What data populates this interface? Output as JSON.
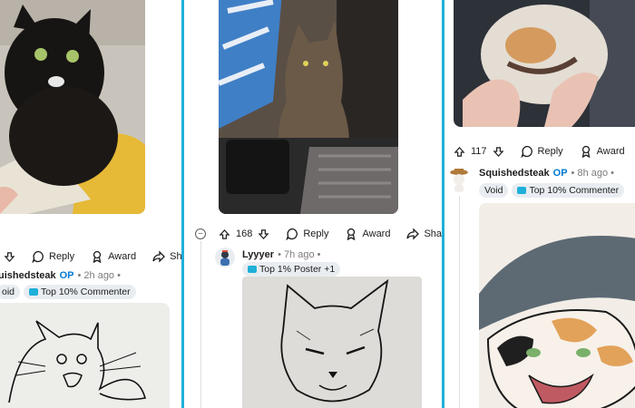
{
  "left": {
    "actions": {
      "reply": "Reply",
      "award": "Award",
      "share": "Sh"
    },
    "comment": {
      "user": "uishedsteak",
      "op": "OP",
      "time": "• 2h ago •",
      "badge_void": "oid",
      "badge_top": "Top 10% Commenter"
    }
  },
  "mid": {
    "actions": {
      "votes": "168",
      "reply": "Reply",
      "award": "Award",
      "share": "Shar"
    },
    "comment": {
      "user": "Lyyyer",
      "time": "• 7h ago •",
      "badge_top": "Top 1% Poster +1"
    }
  },
  "right": {
    "actions": {
      "votes": "117",
      "reply": "Reply",
      "award": "Award"
    },
    "comment": {
      "user": "Squishedsteak",
      "op": "OP",
      "time": "• 8h ago •",
      "badge_void": "Void",
      "badge_top": "Top 10% Commenter"
    }
  },
  "icons": [
    "upvote-icon",
    "downvote-icon",
    "reply-icon",
    "award-icon",
    "share-icon",
    "collapse-icon"
  ]
}
